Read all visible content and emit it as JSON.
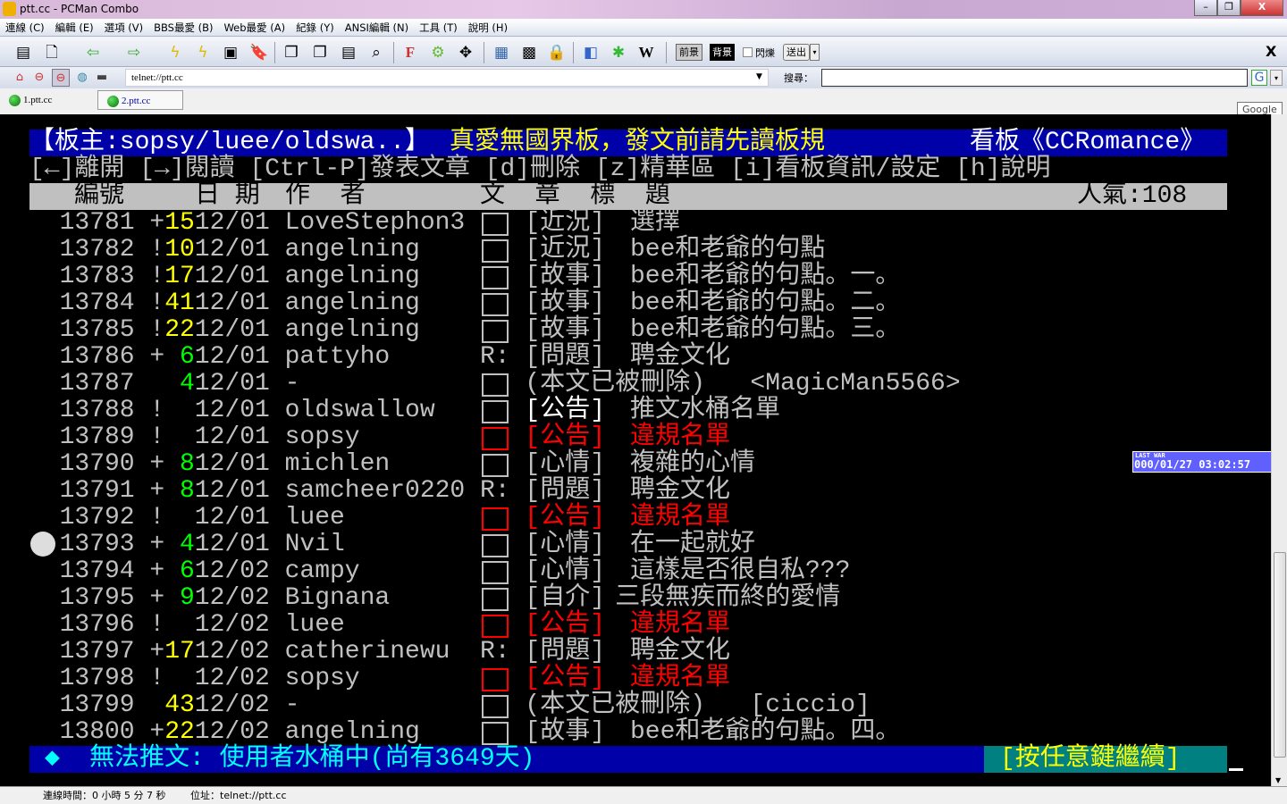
{
  "window": {
    "title": "ptt.cc - PCMan Combo",
    "minimize": "–",
    "restore": "❐",
    "close": "X"
  },
  "menu": [
    "連線 (C)",
    "編輯 (E)",
    "選項 (V)",
    "BBS最愛 (B)",
    "Web最愛 (A)",
    "紀錄 (Y)",
    "ANSI編輯 (N)",
    "工具 (T)",
    "說明 (H)"
  ],
  "toolbar": {
    "fg": "前景",
    "bg": "背景",
    "blink": "閃爍",
    "send": "送出",
    "close": "X",
    "w": "W",
    "f": "F"
  },
  "address": {
    "value": "telnet://ptt.cc",
    "search_label": "搜尋：",
    "search_value": "",
    "google_tip": "Google",
    "g": "G"
  },
  "tabs": [
    {
      "label": "1.ptt.cc"
    },
    {
      "label": "2.ptt.cc"
    }
  ],
  "colors": {
    "blue": "#0000a8",
    "yellow": "#ffff00",
    "green": "#00ff00",
    "red": "#ff0000",
    "cyan": "#00ffff",
    "teal": "#008080"
  },
  "board": {
    "header_left": "【板主:sopsy/luee/oldswa..】",
    "header_mid": "真愛無國界板，發文前請先讀板規",
    "header_right": "看板《CCRomance》",
    "help": "[←]離開 [→]閱讀 [Ctrl-P]發表文章 [d]刪除 [z]精華區 [i]看板資訊/設定 [h]說明",
    "col_num": "編號",
    "col_date": "日 期",
    "col_author": "作  者",
    "col_title": "文  章  標  題",
    "popularity": "人氣:108"
  },
  "rows": [
    {
      "num": "13781",
      "mark": "+",
      "count": "15",
      "cc": "y",
      "date": "12/01",
      "author": "LoveStephon3",
      "flag": "box",
      "cat": "[近況]",
      "title": "選擇",
      "style": "n"
    },
    {
      "num": "13782",
      "mark": "!",
      "count": "10",
      "cc": "y",
      "date": "12/01",
      "author": "angelning",
      "flag": "box",
      "cat": "[近況]",
      "title": "bee和老爺的句點",
      "style": "n"
    },
    {
      "num": "13783",
      "mark": "!",
      "count": "17",
      "cc": "y",
      "date": "12/01",
      "author": "angelning",
      "flag": "box",
      "cat": "[故事]",
      "title": "bee和老爺的句點。一。",
      "style": "n"
    },
    {
      "num": "13784",
      "mark": "!",
      "count": "41",
      "cc": "y",
      "date": "12/01",
      "author": "angelning",
      "flag": "box",
      "cat": "[故事]",
      "title": "bee和老爺的句點。二。",
      "style": "n"
    },
    {
      "num": "13785",
      "mark": "!",
      "count": "22",
      "cc": "y",
      "date": "12/01",
      "author": "angelning",
      "flag": "box",
      "cat": "[故事]",
      "title": "bee和老爺的句點。三。",
      "style": "n"
    },
    {
      "num": "13786",
      "mark": "+",
      "count": " 6",
      "cc": "g",
      "date": "12/01",
      "author": "pattyho",
      "flag": "R:",
      "cat": "[問題]",
      "title": "聘金文化",
      "style": "n"
    },
    {
      "num": "13787",
      "mark": " ",
      "count": " 4",
      "cc": "g",
      "date": "12/01",
      "author": "-",
      "flag": "box",
      "cat": "(本文已被刪除)",
      "title": "<MagicMan5566>",
      "style": "d"
    },
    {
      "num": "13788",
      "mark": "!",
      "count": "  ",
      "cc": "g",
      "date": "12/01",
      "author": "oldswallow",
      "flag": "box",
      "cat": "[公告]",
      "title": "推文水桶名單",
      "style": "w"
    },
    {
      "num": "13789",
      "mark": "!",
      "count": "  ",
      "cc": "g",
      "date": "12/01",
      "author": "sopsy",
      "flag": "redbox",
      "cat": "[公告]",
      "title": "違規名單",
      "style": "r"
    },
    {
      "num": "13790",
      "mark": "+",
      "count": " 8",
      "cc": "g",
      "date": "12/01",
      "author": "michlen",
      "flag": "box",
      "cat": "[心情]",
      "title": "複雜的心情",
      "style": "n"
    },
    {
      "num": "13791",
      "mark": "+",
      "count": " 8",
      "cc": "g",
      "date": "12/01",
      "author": "samcheer0220",
      "flag": "R:",
      "cat": "[問題]",
      "title": "聘金文化",
      "style": "n"
    },
    {
      "num": "13792",
      "mark": "!",
      "count": "  ",
      "cc": "g",
      "date": "12/01",
      "author": "luee",
      "flag": "redbox",
      "cat": "[公告]",
      "title": "違規名單",
      "style": "r"
    },
    {
      "num": "13793",
      "mark": "+",
      "count": " 4",
      "cc": "g",
      "date": "12/01",
      "author": "Nvil",
      "flag": "box",
      "cat": "[心情]",
      "title": "在一起就好",
      "style": "n"
    },
    {
      "num": "13794",
      "mark": "+",
      "count": " 6",
      "cc": "g",
      "date": "12/02",
      "author": "campy",
      "flag": "box",
      "cat": "[心情]",
      "title": "這樣是否很自私???",
      "style": "n"
    },
    {
      "num": "13795",
      "mark": "+",
      "count": " 9",
      "cc": "g",
      "date": "12/02",
      "author": "Bignana",
      "flag": "box",
      "cat": "[自介]",
      "title": "三段無疾而終的愛情",
      "style": "n"
    },
    {
      "num": "13796",
      "mark": "!",
      "count": "  ",
      "cc": "g",
      "date": "12/02",
      "author": "luee",
      "flag": "redbox",
      "cat": "[公告]",
      "title": "違規名單",
      "style": "r"
    },
    {
      "num": "13797",
      "mark": "+",
      "count": "17",
      "cc": "y",
      "date": "12/02",
      "author": "catherinewu",
      "flag": "R:",
      "cat": "[問題]",
      "title": "聘金文化",
      "style": "n"
    },
    {
      "num": "13798",
      "mark": "!",
      "count": "  ",
      "cc": "g",
      "date": "12/02",
      "author": "sopsy",
      "flag": "redbox",
      "cat": "[公告]",
      "title": "違規名單",
      "style": "r"
    },
    {
      "num": "13799",
      "mark": " ",
      "count": "43",
      "cc": "y",
      "date": "12/02",
      "author": "-",
      "flag": "box",
      "cat": "(本文已被刪除)",
      "title": "[ciccio]",
      "style": "d"
    },
    {
      "num": "13800",
      "mark": "+",
      "count": "22",
      "cc": "y",
      "date": "12/02",
      "author": "angelning",
      "flag": "box",
      "cat": "[故事]",
      "title": "bee和老爺的句點。四。",
      "style": "n"
    }
  ],
  "footer": {
    "diamond": "◆",
    "message": "無法推文: 使用者水桶中(尚有3649天)",
    "continue": "[按任意鍵繼續]"
  },
  "lastwar": {
    "label": "LAST WAR",
    "time": "000/01/27 03:02:57"
  },
  "status": {
    "conn_time": "連線時間：0 小時 5 分 7 秒",
    "address": "位址：telnet://ptt.cc"
  }
}
